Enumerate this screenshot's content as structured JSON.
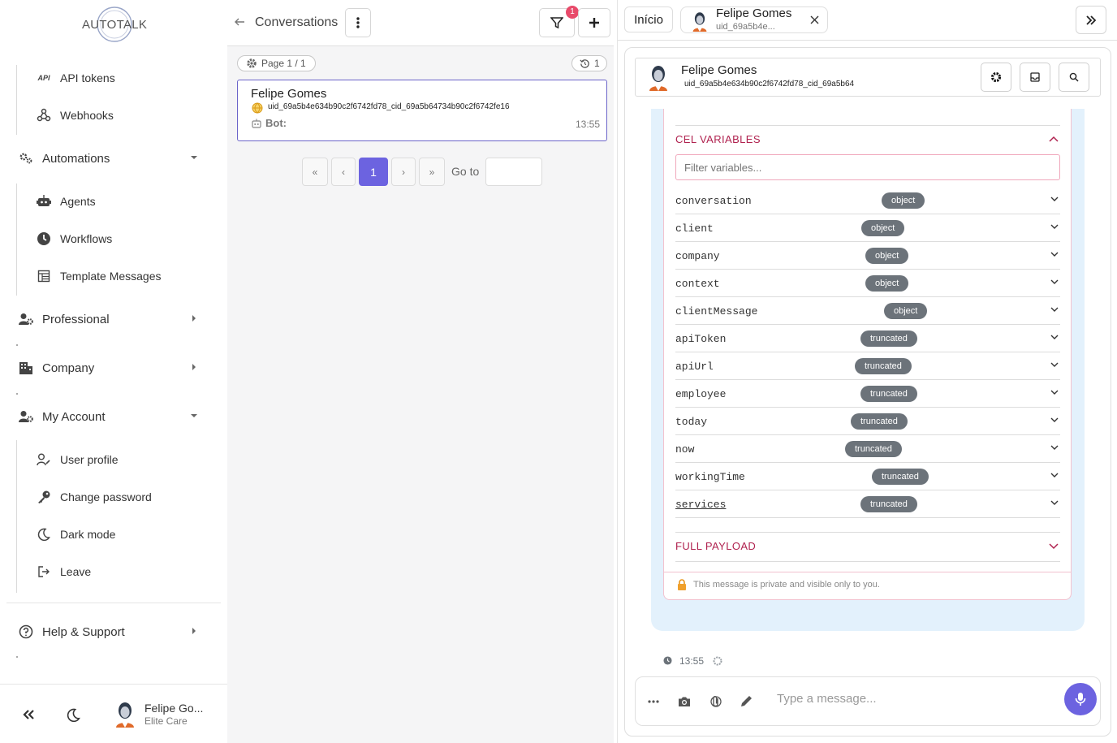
{
  "brand": "AUTOTALK",
  "sidebar": {
    "items": [
      {
        "label": "API tokens"
      },
      {
        "label": "Webhooks"
      },
      {
        "label": "Automations"
      },
      {
        "label": "Agents"
      },
      {
        "label": "Workflows"
      },
      {
        "label": "Template Messages"
      },
      {
        "label": "Professional"
      },
      {
        "label": "Company"
      },
      {
        "label": "My Account"
      },
      {
        "label": "User profile"
      },
      {
        "label": "Change password"
      },
      {
        "label": "Dark mode"
      },
      {
        "label": "Leave"
      },
      {
        "label": "Help & Support"
      }
    ],
    "user": {
      "name": "Felipe Go...",
      "subtitle": "Elite Care"
    }
  },
  "conversations": {
    "title": "Conversations",
    "filter_badge": "1",
    "page_label": "Page 1 / 1",
    "history_count": "1",
    "card": {
      "name": "Felipe Gomes",
      "uid": "uid_69a5b4e634b90c2f6742fd78_cid_69a5b64734b90c2f6742fe16",
      "bot_label": "Bot:",
      "time": "13:55"
    },
    "pagination": {
      "first": "«",
      "prev": "‹",
      "current": "1",
      "next": "›",
      "last": "»",
      "goto_label": "Go to"
    }
  },
  "tabs": {
    "home": "Início",
    "active_name": "Felipe Gomes",
    "active_sub": "uid_69a5b4e..."
  },
  "chat": {
    "name": "Felipe Gomes",
    "uid": "uid_69a5b4e634b90c2f6742fd78_cid_69a5b64",
    "section_title": "CEL VARIABLES",
    "filter_placeholder": "Filter variables...",
    "variables": [
      {
        "key": "conversation",
        "type": "object"
      },
      {
        "key": "client",
        "type": "object"
      },
      {
        "key": "company",
        "type": "object"
      },
      {
        "key": "context",
        "type": "object"
      },
      {
        "key": "clientMessage",
        "type": "object"
      },
      {
        "key": "apiToken",
        "type": "truncated"
      },
      {
        "key": "apiUrl",
        "type": "truncated"
      },
      {
        "key": "employee",
        "type": "truncated"
      },
      {
        "key": "today",
        "type": "truncated"
      },
      {
        "key": "now",
        "type": "truncated"
      },
      {
        "key": "workingTime",
        "type": "truncated"
      },
      {
        "key": "services",
        "type": "truncated"
      }
    ],
    "full_payload": "FULL PAYLOAD",
    "private_note": "This message is private and visible only to you.",
    "time": "13:55",
    "composer_placeholder": "Type a message..."
  },
  "colors": {
    "accent": "#6c63e0",
    "section": "#b0224f",
    "badge": "#6c737a",
    "filter_badge": "#e84a6a"
  }
}
